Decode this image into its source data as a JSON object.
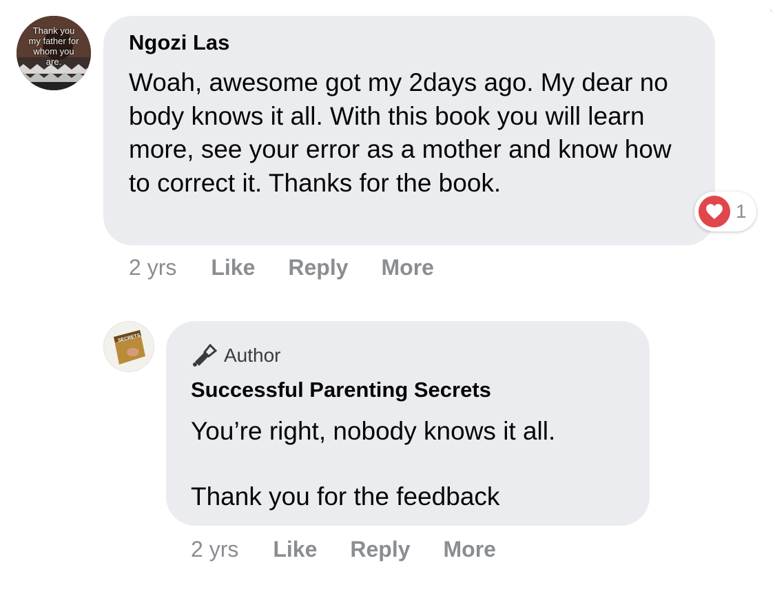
{
  "comment": {
    "avatar_text": "Thank you\nmy father for\nwhom you\nare.",
    "author_name": "Ngozi Las",
    "text": "Woah, awesome got my 2days ago. My dear no body knows it all. With this book you will learn more, see your error as a mother and know how to correct it. Thanks for the book.",
    "time": "2 yrs",
    "like_label": "Like",
    "reply_label": "Reply",
    "more_label": "More",
    "reaction": {
      "icon": "heart-icon",
      "count": "1",
      "color": "#e0474c"
    }
  },
  "reply": {
    "badge_icon": "megaphone-icon",
    "badge_label": "Author",
    "author_name": "Successful Parenting Secrets",
    "avatar_text": "SECRETS",
    "line1": "You’re right, nobody knows it all.",
    "line2": "Thank you for the feedback",
    "time": "2 yrs",
    "like_label": "Like",
    "reply_label": "Reply",
    "more_label": "More"
  },
  "colors": {
    "bubble": "#ebecf0",
    "action_text": "#8a8d91",
    "primary_text": "#050505"
  }
}
